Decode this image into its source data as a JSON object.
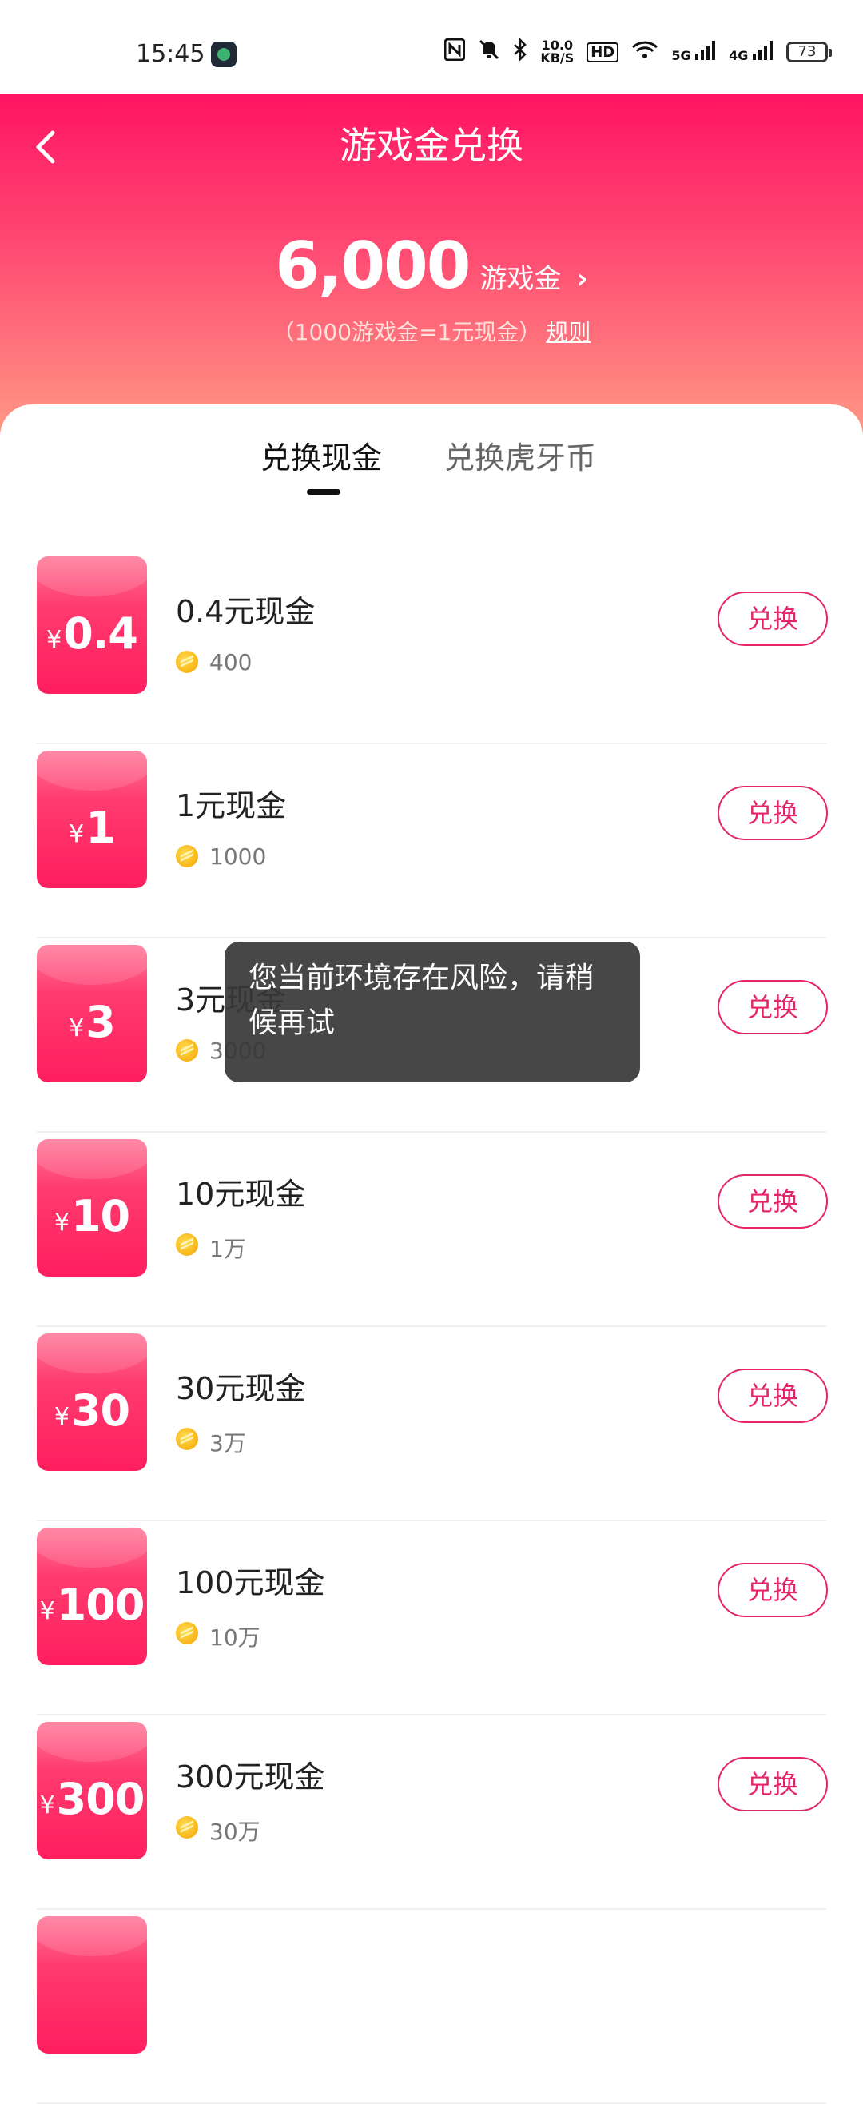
{
  "status_bar": {
    "time": "15:45",
    "speed_top": "10.0",
    "speed_bottom": "KB/S",
    "hd": "HD",
    "net_5g": "5G",
    "net_4g": "4G",
    "battery": "73",
    "icons": [
      "nfc-icon",
      "mute-icon",
      "bluetooth-icon",
      "wifi-icon",
      "signal-icon"
    ]
  },
  "header": {
    "title": "游戏金兑换",
    "balance": "6,000",
    "balance_unit": "游戏金",
    "rate_text": "（1000游戏金=1元现金）",
    "rule_label": "规则",
    "colors": {
      "top": "#ff1463",
      "bottom": "#ff9a85"
    }
  },
  "tabs": [
    {
      "label": "兑换现金",
      "active": true
    },
    {
      "label": "兑换虎牙币",
      "active": false
    }
  ],
  "items": [
    {
      "yen": "¥",
      "value": "0.4",
      "name": "0.4元现金",
      "cost": "400",
      "button": "兑换"
    },
    {
      "yen": "¥",
      "value": "1",
      "name": "1元现金",
      "cost": "1000",
      "button": "兑换"
    },
    {
      "yen": "¥",
      "value": "3",
      "name": "3元现金",
      "cost": "3000",
      "button": "兑换"
    },
    {
      "yen": "¥",
      "value": "10",
      "name": "10元现金",
      "cost": "1万",
      "button": "兑换"
    },
    {
      "yen": "¥",
      "value": "30",
      "name": "30元现金",
      "cost": "3万",
      "button": "兑换"
    },
    {
      "yen": "¥",
      "value": "100",
      "name": "100元现金",
      "cost": "10万",
      "button": "兑换"
    },
    {
      "yen": "¥",
      "value": "300",
      "name": "300元现金",
      "cost": "30万",
      "button": "兑换"
    }
  ],
  "toast": {
    "message": "您当前环境存在风险，请稍候再试"
  },
  "accent_color": "#e6246a"
}
